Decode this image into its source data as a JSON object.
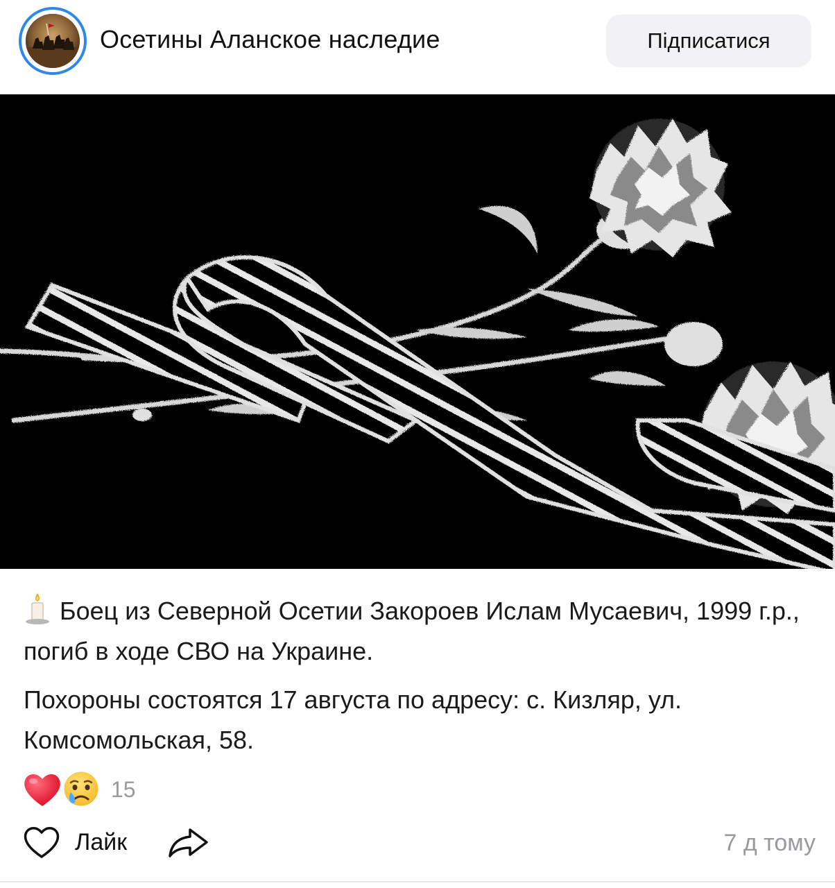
{
  "group": {
    "name": "Осетины Аланское наследие",
    "subscribe_label": "Підписатися"
  },
  "post": {
    "paragraphs": [
      "Боец из Северной Осетии Закороев Ислам Мусаевич, 1999 г.р., погиб в ходе СВО на Украине.",
      "Похороны состоятся 17 августа по адресу: с. Кизляр, ул. Комсомольская, 58."
    ],
    "leading_icon": "candle-icon",
    "image": "carnations-and-ribbon-image"
  },
  "reactions": {
    "icons": [
      "heart-emoji",
      "crying-face-emoji"
    ],
    "count": "15"
  },
  "actions": {
    "like_label": "Лайк",
    "share_icon": "share-icon"
  },
  "timestamp": "7 д тому",
  "colors": {
    "accent_ring": "#2d88e8",
    "button_bg": "#f2f2f4",
    "muted_text": "#9a9a9e"
  }
}
